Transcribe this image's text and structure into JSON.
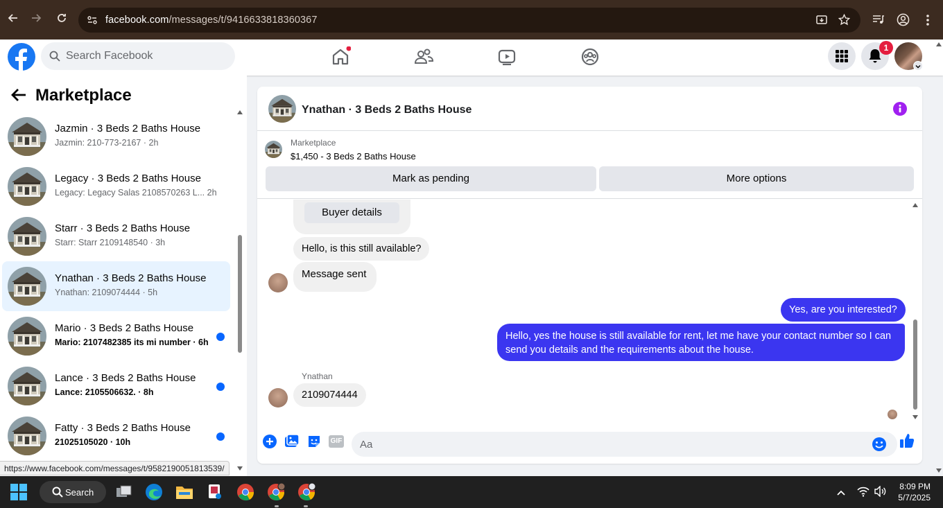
{
  "browser": {
    "url_host": "facebook.com",
    "url_path": "/messages/t/9416633818360367"
  },
  "facebook": {
    "search_placeholder": "Search Facebook",
    "notification_count": "1"
  },
  "sidebar": {
    "title": "Marketplace",
    "conversations": [
      {
        "name": "Jazmin · 3 Beds 2 Baths House",
        "preview": "Jazmin: 210-773-2167 · 2h",
        "unread": false,
        "active": false
      },
      {
        "name": "Legacy · 3 Beds 2 Baths House",
        "preview": "Legacy: Legacy Salas 2108570263 L...  2h",
        "unread": false,
        "active": false
      },
      {
        "name": "Starr · 3 Beds 2 Baths House",
        "preview": "Starr: Starr 2109148540 · 3h",
        "unread": false,
        "active": false
      },
      {
        "name": "Ynathan · 3 Beds 2 Baths House",
        "preview": "Ynathan: 2109074444 · 5h",
        "unread": false,
        "active": true
      },
      {
        "name": "Mario · 3 Beds 2 Baths House",
        "preview": "Mario: 2107482385 its mi number · 6h",
        "unread": true,
        "active": false
      },
      {
        "name": "Lance · 3 Beds 2 Baths House",
        "preview": "Lance: 2105506632. · 8h",
        "unread": true,
        "active": false
      },
      {
        "name": "Fatty · 3 Beds 2 Baths House",
        "preview": "21025105020 · 10h",
        "unread": true,
        "active": false
      }
    ]
  },
  "chat": {
    "title": "Ynathan · 3 Beds 2 Baths House",
    "marketplace_label": "Marketplace",
    "listing": "$1,450 - 3 Beds 2 Baths House",
    "mark_pending": "Mark as pending",
    "more_options": "More options",
    "buyer_details": "Buyer details",
    "messages": {
      "m1": "Hello, is this still available?",
      "m2": "Message sent",
      "m3": "Yes, are you interested?",
      "m4": "Hello, yes the house is still available for rent, let me have your contact number so I can send you details and the requirements about the house.",
      "sender": "Ynathan",
      "m5": "2109074444"
    },
    "composer_placeholder": "Aa",
    "gif_label": "GIF"
  },
  "status_url": "https://www.facebook.com/messages/t/9582190051813539/",
  "taskbar": {
    "search": "Search",
    "time": "8:09 PM",
    "date": "5/7/2025"
  },
  "colors": {
    "fb_blue": "#1877f2",
    "outgoing_bubble": "#3b36f0",
    "unread_dot": "#0866ff",
    "info_icon": "#a020f0",
    "chrome_frame": "#3c2b20"
  }
}
